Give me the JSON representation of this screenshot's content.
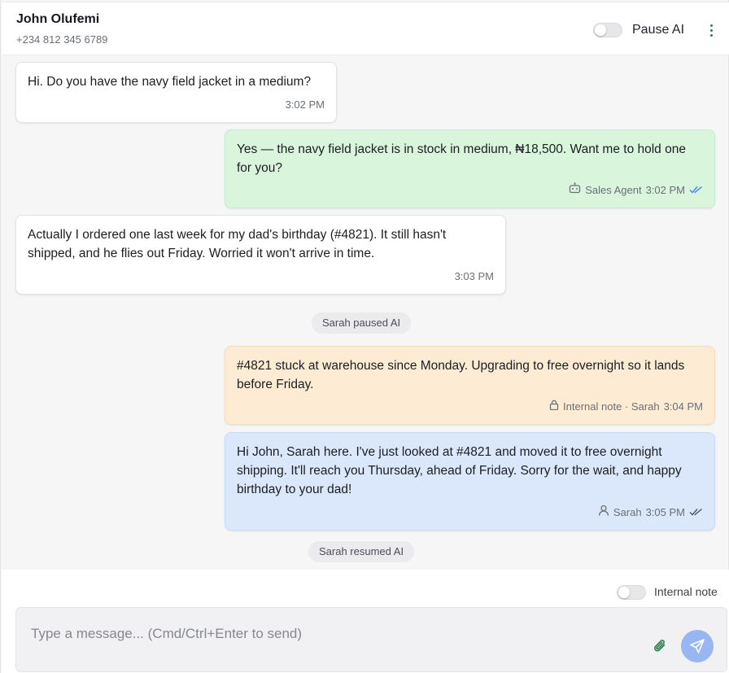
{
  "header": {
    "contact_name": "John Olufemi",
    "contact_phone": "+234 812 345 6789",
    "pause_ai_label": "Pause AI",
    "pause_ai_on": false,
    "menu_icon": "more-vertical-icon"
  },
  "messages": [
    {
      "direction": "incoming",
      "text": "Hi. Do you have the navy field jacket in a medium?",
      "time": "3:02 PM"
    },
    {
      "direction": "outgoing-ai",
      "text": "Yes — the navy field jacket is in stock in medium, ₦18,500. Want me to hold one for you?",
      "sender": "Sales Agent",
      "time": "3:02 PM",
      "sender_icon": "bot-icon",
      "status_icon": "double-check-icon",
      "status_color": "#3b82f6"
    },
    {
      "direction": "incoming",
      "text": "Actually I ordered one last week for my dad's birthday (#4821). It still hasn't shipped, and he flies out Friday. Worried it won't arrive in time.",
      "time": "3:03 PM"
    },
    {
      "direction": "outgoing-note",
      "text": "#4821 stuck at warehouse since Monday. Upgrading to free overnight so it lands before Friday.",
      "sender": "Internal note · Sarah",
      "time": "3:04 PM",
      "sender_icon": "lock-icon"
    },
    {
      "direction": "outgoing-agent",
      "text": "Hi John, Sarah here. I've just looked at #4821 and moved it to free overnight shipping. It'll reach you Thursday, ahead of Friday. Sorry for the wait, and happy birthday to your dad!",
      "sender": "Sarah",
      "time": "3:05 PM",
      "sender_icon": "user-icon",
      "status_icon": "double-check-icon",
      "status_color": "#4b5563"
    }
  ],
  "system_events": [
    "Sarah paused AI",
    "Sarah resumed AI"
  ],
  "composer": {
    "internal_note_label": "Internal note",
    "internal_note_on": false,
    "placeholder": "Type a message... (Cmd/Ctrl+Enter to send)",
    "value": "",
    "attach_icon": "paperclip-icon",
    "send_icon": "send-icon"
  },
  "colors": {
    "ai_bubble": "#d9f6dd",
    "note_bubble": "#fdebd3",
    "agent_bubble": "#dbe8fb",
    "send_button": "#97b6f2",
    "accent_green": "#2f7d4f"
  }
}
